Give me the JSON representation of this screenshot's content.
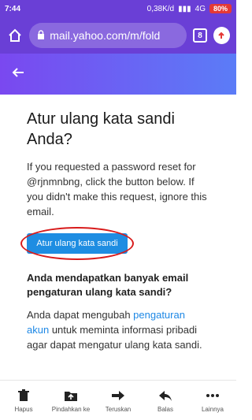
{
  "status": {
    "time": "7:44",
    "speed": "0,38K/d",
    "network": "4G",
    "battery": "80%"
  },
  "browser": {
    "url": "mail.yahoo.com/m/fold",
    "tab_count": "8"
  },
  "email": {
    "title": "Atur ulang kata sandi Anda?",
    "body": "If you requested a password reset for @rjnmnbng, click the button below. If you didn't make this request, ignore this email.",
    "button_label": "Atur ulang kata sandi",
    "subheading": "Anda mendapatkan banyak email pengaturan ulang kata sandi?",
    "info_prefix": "Anda dapat mengubah ",
    "info_link": "pengaturan akun",
    "info_suffix": " untuk meminta informasi pribadi agar dapat mengatur ulang kata sandi."
  },
  "toolbar": {
    "delete": "Hapus",
    "move": "Pindahkan ke",
    "forward": "Teruskan",
    "reply": "Balas",
    "more": "Lainnya"
  },
  "colors": {
    "header": "#6a3fd6",
    "button": "#1e8de2",
    "highlight": "#d81b1b",
    "link": "#1e88e5"
  }
}
